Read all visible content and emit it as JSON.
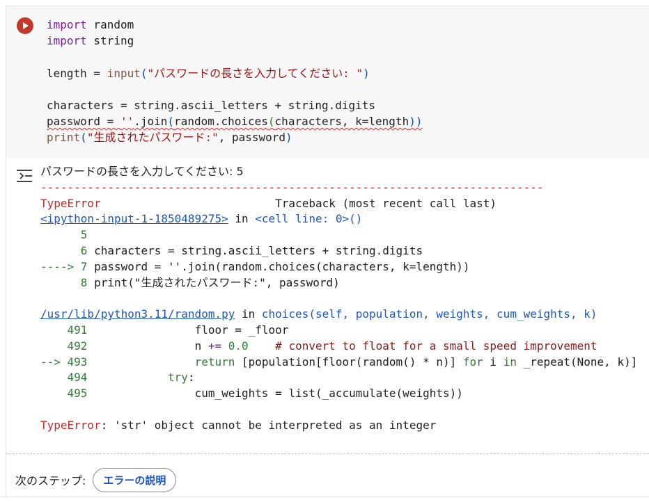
{
  "cell": {
    "code_lines": {
      "l1_kw": "import",
      "l1_mod": " random",
      "l2_kw": "import",
      "l2_mod": " string",
      "l4_a": "length = ",
      "l4_fn": "input",
      "l4_p1": "(",
      "l4_str": "\"パスワードの長さを入力してください: \"",
      "l4_p2": ")",
      "l6": "characters = string.ascii_letters + string.digits",
      "l7_a": "password = ",
      "l7_str": "''",
      "l7_b": ".join",
      "l7_p1": "(",
      "l7_c": "random.choices",
      "l7_p2": "(",
      "l7_d": "characters, k=length",
      "l7_p3": "))",
      "l8_fn": "print",
      "l8_p1": "(",
      "l8_str": "\"生成されたパスワード:\"",
      "l8_b": ", password",
      "l8_p2": ")"
    },
    "run_icon": "play-icon",
    "output_icon": "output-toggle-icon"
  },
  "output": {
    "prompt_line": "パスワードの長さを入力してください: 5",
    "dashes": "---------------------------------------------------------------------------",
    "err_type": "TypeError",
    "traceback_label": "Traceback (most recent call last)",
    "ipy_link": "<ipython-input-1-1850489275>",
    "in_word": " in ",
    "cell_line": "<cell line: 0>",
    "cell_paren": "()",
    "tb1": [
      {
        "prefix": "      ",
        "num": "5",
        "code": ""
      },
      {
        "prefix": "      ",
        "num": "6",
        "code": " characters = string.ascii_letters + string.digits"
      },
      {
        "prefix": "----> ",
        "num": "7",
        "code": " password = ''.join(random.choices(characters, k=length))"
      },
      {
        "prefix": "      ",
        "num": "8",
        "code": " print(\"生成されたパスワード:\", password)"
      }
    ],
    "random_link": "/usr/lib/python3.11/random.py",
    "choices_fn": "choices",
    "choices_args": "(self, population, weights, cum_weights, k)",
    "tb2_491_num": "    491",
    "tb2_491_code": "                floor = _floor",
    "tb2_492_num": "    492",
    "tb2_492_a": "                n ",
    "tb2_492_op": "+=",
    "tb2_492_b": " ",
    "tb2_492_val": "0.0",
    "tb2_492_c": "    ",
    "tb2_492_cmt": "# convert to float for a small speed improvement",
    "tb2_493_arrow": "--> ",
    "tb2_493_num": "493",
    "tb2_493_a": "                ",
    "tb2_493_kw": "return",
    "tb2_493_b": " [population[floor(random() * n)] ",
    "tb2_493_for": "for",
    "tb2_493_c": " i ",
    "tb2_493_in": "in",
    "tb2_493_d": " _repeat(None, k)]",
    "tb2_494_num": "    494",
    "tb2_494_a": "            ",
    "tb2_494_kw": "try",
    "tb2_494_b": ":",
    "tb2_495_num": "    495",
    "tb2_495_code": "                cum_weights = list(_accumulate(weights))",
    "final_err_type": "TypeError",
    "final_err_msg": ": 'str' object cannot be interpreted as an integer"
  },
  "next_steps": {
    "label": "次のステップ:",
    "chip": "エラーの説明"
  },
  "colors": {
    "run_button": "#c0392b",
    "error_red": "#c62828",
    "link_blue": "#1a56c4",
    "line_green": "#2e7d32"
  }
}
